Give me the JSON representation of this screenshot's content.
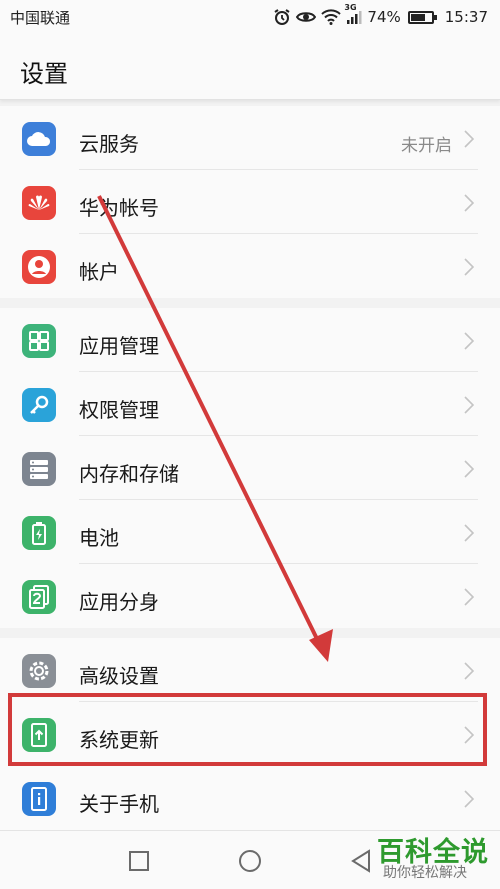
{
  "status_bar": {
    "carrier": "中国联通",
    "network": "3G",
    "battery": "74%",
    "battery_level": 0.74,
    "time": "15:37"
  },
  "app_bar": {
    "title": "设置"
  },
  "groups": [
    {
      "items": [
        {
          "label": "云服务",
          "value": "未开启",
          "icon": "cloud-icon",
          "color": "#3d7fd9"
        },
        {
          "label": "华为帐号",
          "icon": "huawei-icon",
          "color": "#e8453c"
        },
        {
          "label": "帐户",
          "icon": "user-icon",
          "color": "#e8453c"
        }
      ]
    },
    {
      "items": [
        {
          "label": "应用管理",
          "icon": "grid-icon",
          "color": "#3db37a"
        },
        {
          "label": "权限管理",
          "icon": "key-icon",
          "color": "#2aa3d9"
        },
        {
          "label": "内存和存储",
          "icon": "storage-icon",
          "color": "#7d8590"
        },
        {
          "label": "电池",
          "icon": "battery-icon",
          "color": "#3db36a"
        },
        {
          "label": "应用分身",
          "icon": "twin-app-icon",
          "color": "#3db36a"
        }
      ]
    },
    {
      "items": [
        {
          "label": "高级设置",
          "icon": "gear-icon",
          "color": "#8a8f96"
        },
        {
          "label": "系统更新",
          "icon": "system-update-icon",
          "color": "#3db36a"
        },
        {
          "label": "关于手机",
          "icon": "phone-info-icon",
          "color": "#2f7ed8"
        }
      ]
    }
  ],
  "watermark": {
    "title": "百科全说",
    "subtitle": "助你轻松解决"
  }
}
